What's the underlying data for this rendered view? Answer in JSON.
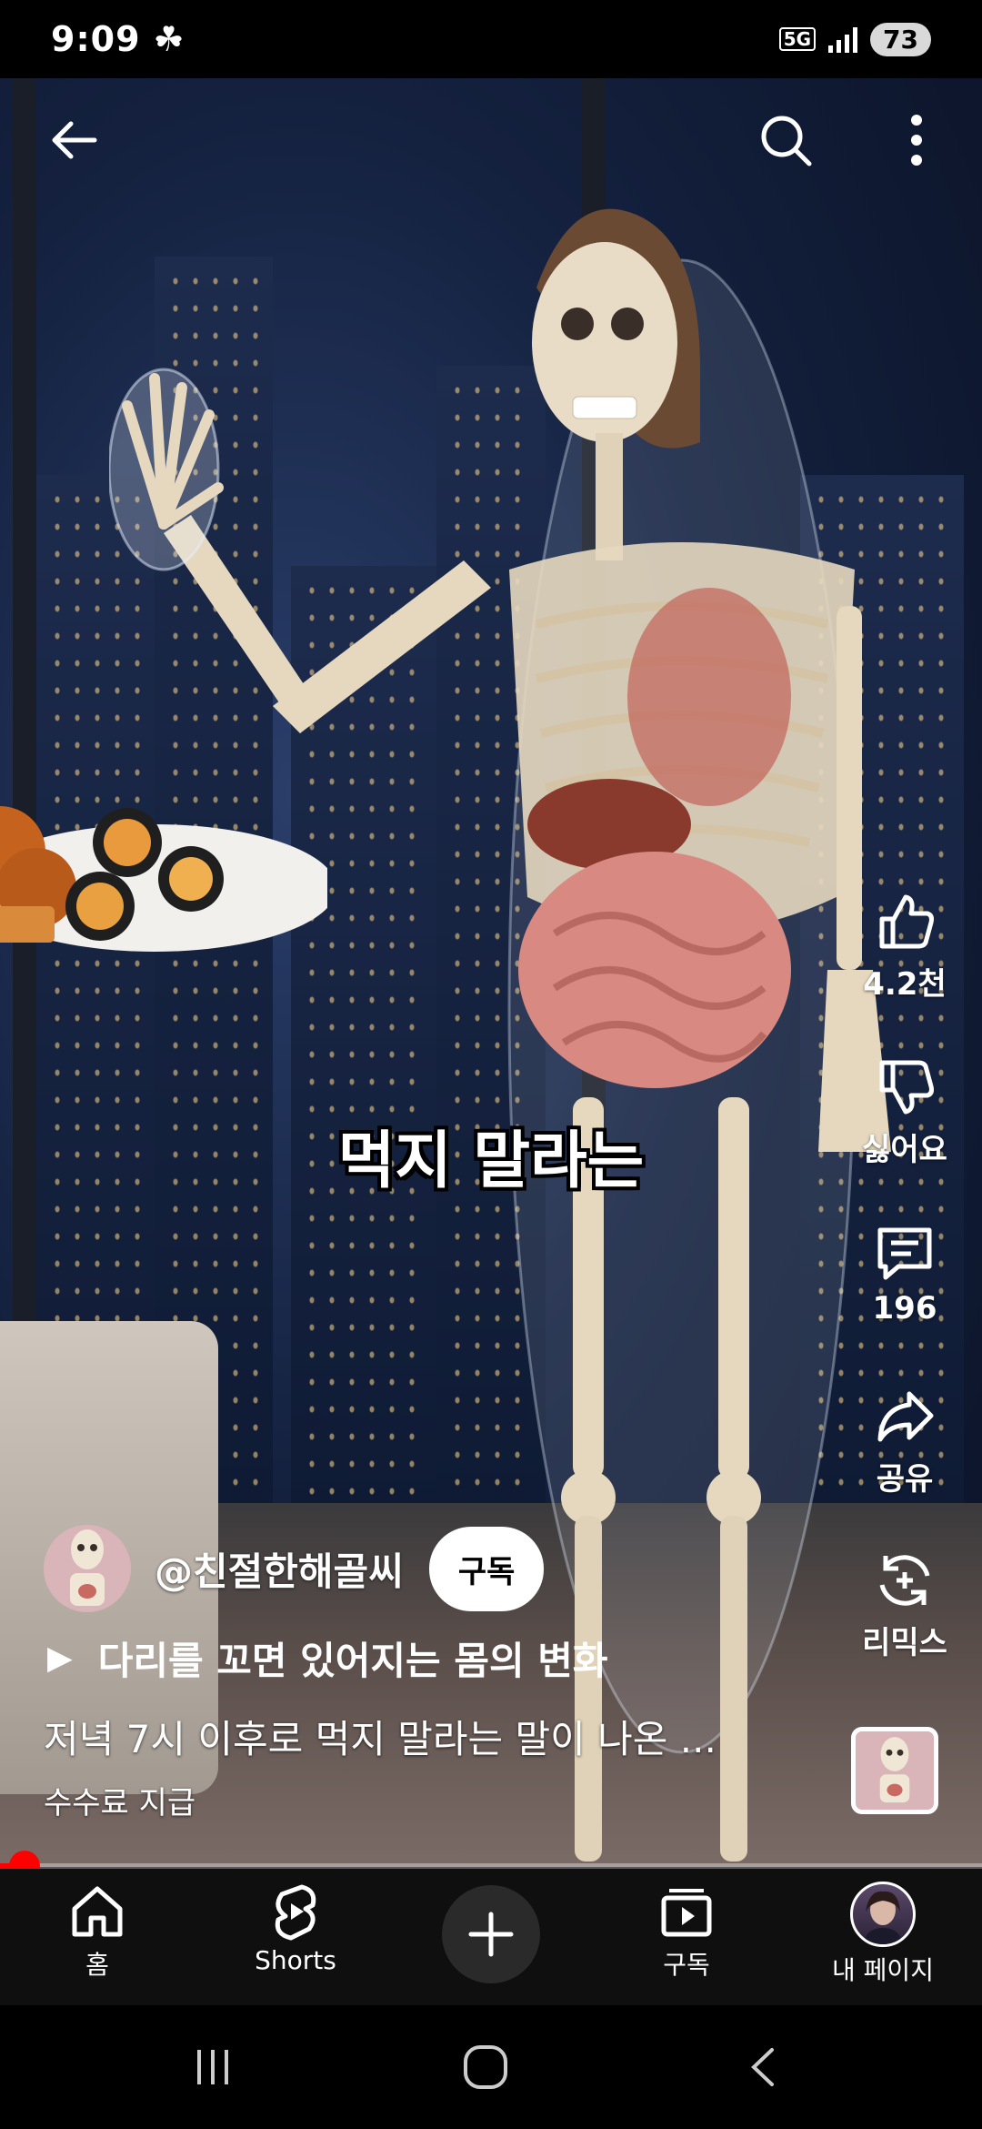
{
  "status_bar": {
    "time": "9:09",
    "network": "5G",
    "battery": "73"
  },
  "video": {
    "caption": "먹지 말라는",
    "actions": {
      "like_count": "4.2천",
      "dislike_label": "싫어요",
      "comment_count": "196",
      "share_label": "공유",
      "remix_label": "리믹스"
    },
    "channel": {
      "handle": "@친절한해골씨",
      "subscribe_label": "구독"
    },
    "linked_video_title": "다리를 꼬면 있어지는 몸의 변화",
    "description": "저녁 7시 이후로 먹지 말라는 말이 나온 ...",
    "paid_promotion": "수수료 지급",
    "progress": 0.025
  },
  "bottom_nav": {
    "items": [
      {
        "label": "홈",
        "icon": "home-icon"
      },
      {
        "label": "Shorts",
        "icon": "shorts-icon"
      },
      {
        "label": "",
        "icon": "create-icon"
      },
      {
        "label": "구독",
        "icon": "subscriptions-icon"
      },
      {
        "label": "내 페이지",
        "icon": "avatar"
      }
    ]
  },
  "colors": {
    "accent": "#ff0000",
    "nav_bg": "#0f0f0f"
  }
}
